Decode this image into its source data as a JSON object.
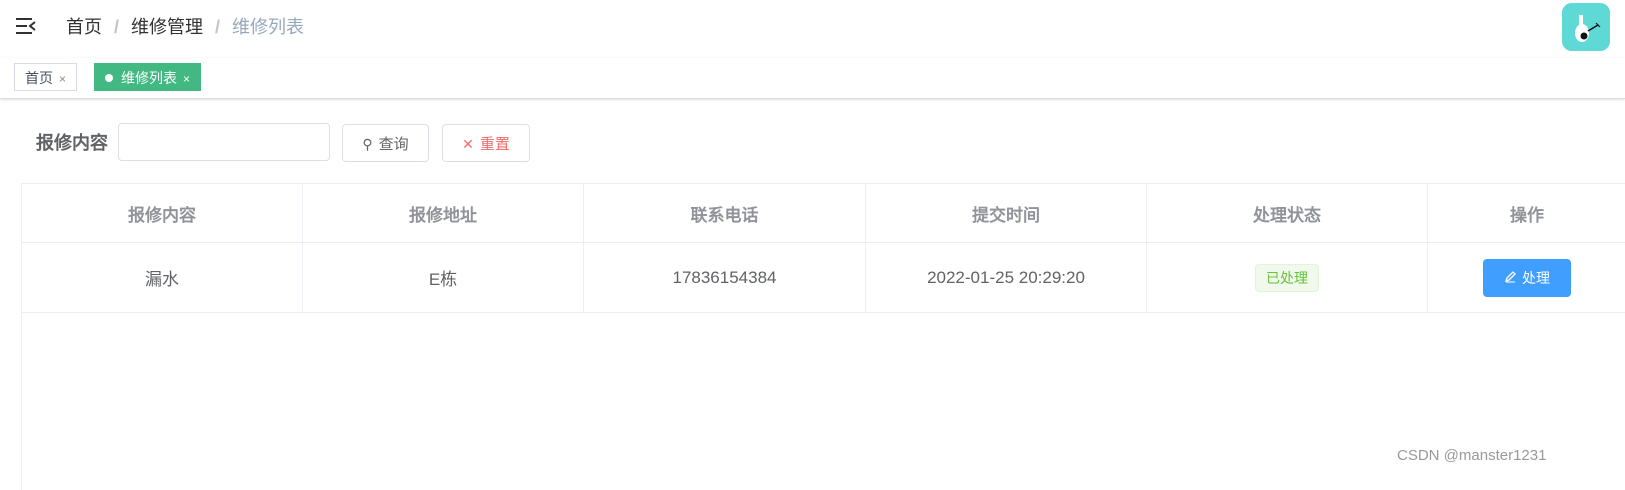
{
  "navbar": {
    "breadcrumb": [
      "首页",
      "维修管理",
      "维修列表"
    ],
    "separator": "/"
  },
  "tags": [
    {
      "label": "首页",
      "close": "×",
      "active": false
    },
    {
      "label": "维修列表",
      "close": "×",
      "active": true
    }
  ],
  "filter": {
    "label": "报修内容",
    "input_value": "",
    "search_label": "查询",
    "reset_label": "重置"
  },
  "table": {
    "columns": [
      "报修内容",
      "报修地址",
      "联系电话",
      "提交时间",
      "处理状态",
      "操作"
    ],
    "rows": [
      {
        "content": "漏水",
        "address": "E栋",
        "phone": "17836154384",
        "time": "2022-01-25 20:29:20",
        "status": "已处理",
        "action": "处理"
      }
    ]
  },
  "watermark": "CSDN @manster1231",
  "colors": {
    "accent": "#42b983",
    "primary": "#409eff",
    "danger": "#f56c6c",
    "success": "#67c23a"
  }
}
